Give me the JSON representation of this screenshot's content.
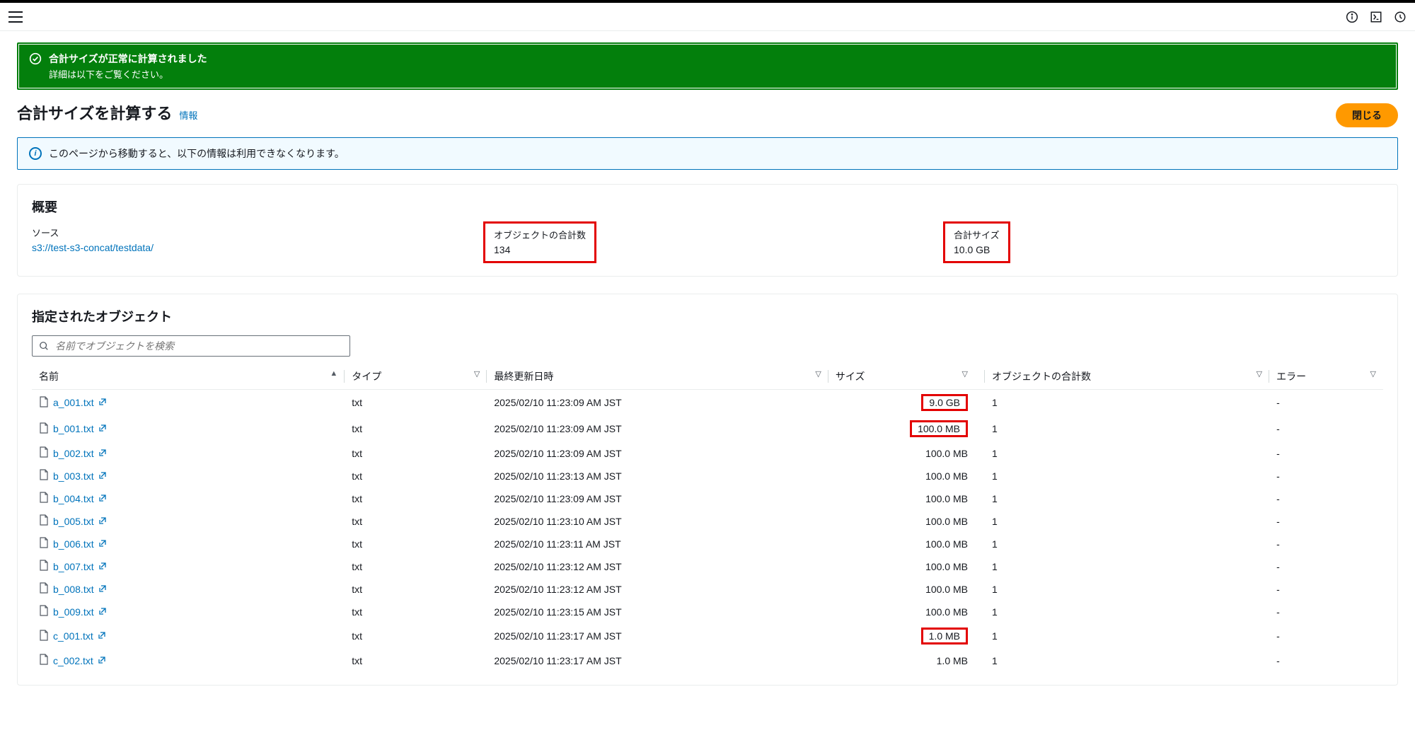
{
  "alert_success": {
    "title": "合計サイズが正常に計算されました",
    "subtitle": "詳細は以下をご覧ください。"
  },
  "page": {
    "title": "合計サイズを計算する",
    "info_link": "情報",
    "close_btn": "閉じる"
  },
  "alert_info": {
    "text": "このページから移動すると、以下の情報は利用できなくなります。"
  },
  "summary": {
    "panel_title": "概要",
    "source_label": "ソース",
    "source_value": "s3://test-s3-concat/testdata/",
    "count_label": "オブジェクトの合計数",
    "count_value": "134",
    "size_label": "合計サイズ",
    "size_value": "10.0 GB"
  },
  "objects": {
    "panel_title": "指定されたオブジェクト",
    "search_placeholder": "名前でオブジェクトを検索",
    "columns": {
      "name": "名前",
      "type": "タイプ",
      "updated": "最終更新日時",
      "size": "サイズ",
      "count": "オブジェクトの合計数",
      "error": "エラー"
    },
    "rows": [
      {
        "name": "a_001.txt",
        "type": "txt",
        "updated": "2025/02/10 11:23:09 AM JST",
        "size": "9.0 GB",
        "count": "1",
        "error": "-",
        "size_hl": true
      },
      {
        "name": "b_001.txt",
        "type": "txt",
        "updated": "2025/02/10 11:23:09 AM JST",
        "size": "100.0 MB",
        "count": "1",
        "error": "-",
        "size_hl": true
      },
      {
        "name": "b_002.txt",
        "type": "txt",
        "updated": "2025/02/10 11:23:09 AM JST",
        "size": "100.0 MB",
        "count": "1",
        "error": "-",
        "size_hl": false
      },
      {
        "name": "b_003.txt",
        "type": "txt",
        "updated": "2025/02/10 11:23:13 AM JST",
        "size": "100.0 MB",
        "count": "1",
        "error": "-",
        "size_hl": false
      },
      {
        "name": "b_004.txt",
        "type": "txt",
        "updated": "2025/02/10 11:23:09 AM JST",
        "size": "100.0 MB",
        "count": "1",
        "error": "-",
        "size_hl": false
      },
      {
        "name": "b_005.txt",
        "type": "txt",
        "updated": "2025/02/10 11:23:10 AM JST",
        "size": "100.0 MB",
        "count": "1",
        "error": "-",
        "size_hl": false
      },
      {
        "name": "b_006.txt",
        "type": "txt",
        "updated": "2025/02/10 11:23:11 AM JST",
        "size": "100.0 MB",
        "count": "1",
        "error": "-",
        "size_hl": false
      },
      {
        "name": "b_007.txt",
        "type": "txt",
        "updated": "2025/02/10 11:23:12 AM JST",
        "size": "100.0 MB",
        "count": "1",
        "error": "-",
        "size_hl": false
      },
      {
        "name": "b_008.txt",
        "type": "txt",
        "updated": "2025/02/10 11:23:12 AM JST",
        "size": "100.0 MB",
        "count": "1",
        "error": "-",
        "size_hl": false
      },
      {
        "name": "b_009.txt",
        "type": "txt",
        "updated": "2025/02/10 11:23:15 AM JST",
        "size": "100.0 MB",
        "count": "1",
        "error": "-",
        "size_hl": false
      },
      {
        "name": "c_001.txt",
        "type": "txt",
        "updated": "2025/02/10 11:23:17 AM JST",
        "size": "1.0 MB",
        "count": "1",
        "error": "-",
        "size_hl": true
      },
      {
        "name": "c_002.txt",
        "type": "txt",
        "updated": "2025/02/10 11:23:17 AM JST",
        "size": "1.0 MB",
        "count": "1",
        "error": "-",
        "size_hl": false
      }
    ]
  }
}
